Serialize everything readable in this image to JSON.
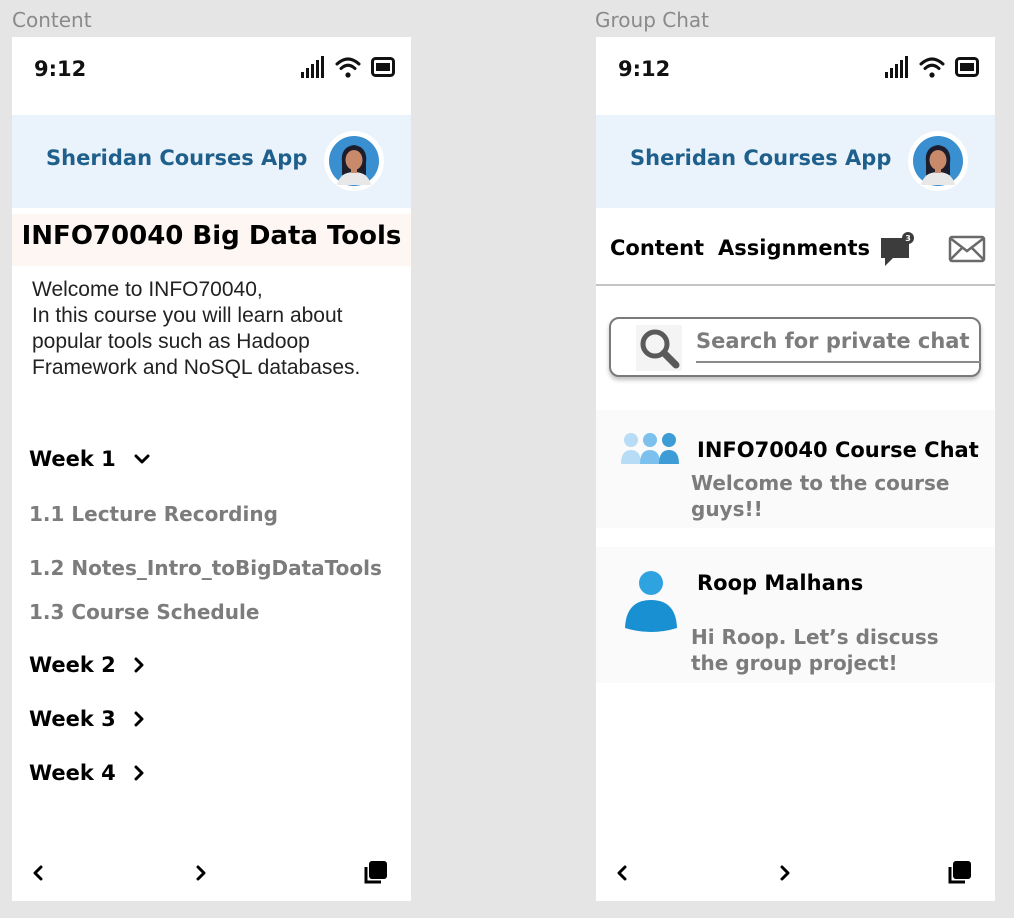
{
  "frames": {
    "content_label": "Content",
    "chat_label": "Group Chat"
  },
  "status": {
    "time": "9:12",
    "icons": [
      "signal-icon",
      "wifi-icon",
      "battery-icon"
    ]
  },
  "app": {
    "title": "Sheridan Courses App",
    "avatar_icon": "user-avatar-icon"
  },
  "content_screen": {
    "course_title": "INFO70040 Big Data Tools",
    "welcome": "Welcome to INFO70040,\nIn this course you will learn about popular tools such as Hadoop Framework and NoSQL databases.",
    "weeks": [
      {
        "label": "Week 1",
        "expanded": true
      },
      {
        "label": "Week 2",
        "expanded": false
      },
      {
        "label": "Week 3",
        "expanded": false
      },
      {
        "label": "Week 4",
        "expanded": false
      }
    ],
    "lessons": [
      "1.1 Lecture Recording",
      "1.2 Notes_Intro_toBigDataTools",
      "1.3 Course Schedule"
    ]
  },
  "chat_screen": {
    "tabs": [
      "Content",
      "Assignments"
    ],
    "chat_badge": "3",
    "search_placeholder": "Search for private chat",
    "chats": [
      {
        "name": "INFO70040 Course Chat",
        "message": "Welcome to the course guys!!",
        "icon": "group-icon"
      },
      {
        "name": "Roop Malhans",
        "message": "Hi Roop. Let’s discuss the group project!",
        "icon": "person-icon"
      }
    ]
  },
  "bottom_nav": {
    "icons": [
      "chevron-left-icon",
      "chevron-right-icon",
      "tabs-icon"
    ]
  },
  "colors": {
    "accent": "#1f5f8b",
    "header_bg": "#eaf3fb",
    "muted_text": "#7c7c7c"
  }
}
